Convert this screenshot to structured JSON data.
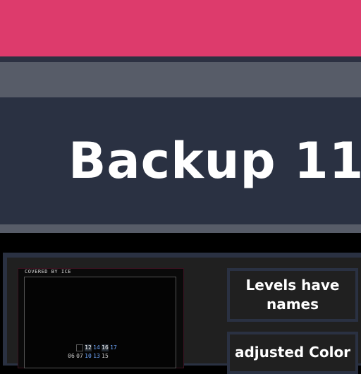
{
  "title": "Backup 11",
  "preview": {
    "caption": "COVERED BY ICE",
    "grid_rows": [
      [
        "",
        "12",
        "14",
        "16",
        "17"
      ],
      [
        "06",
        "07",
        "10",
        "13",
        "15"
      ]
    ]
  },
  "buttons": {
    "levels": "Levels have names",
    "color": "adjusted Color"
  },
  "colors": {
    "banner": "#dd3b6c",
    "panel": "#2a3142",
    "gray": "#575c68",
    "text": "#ffffff"
  }
}
